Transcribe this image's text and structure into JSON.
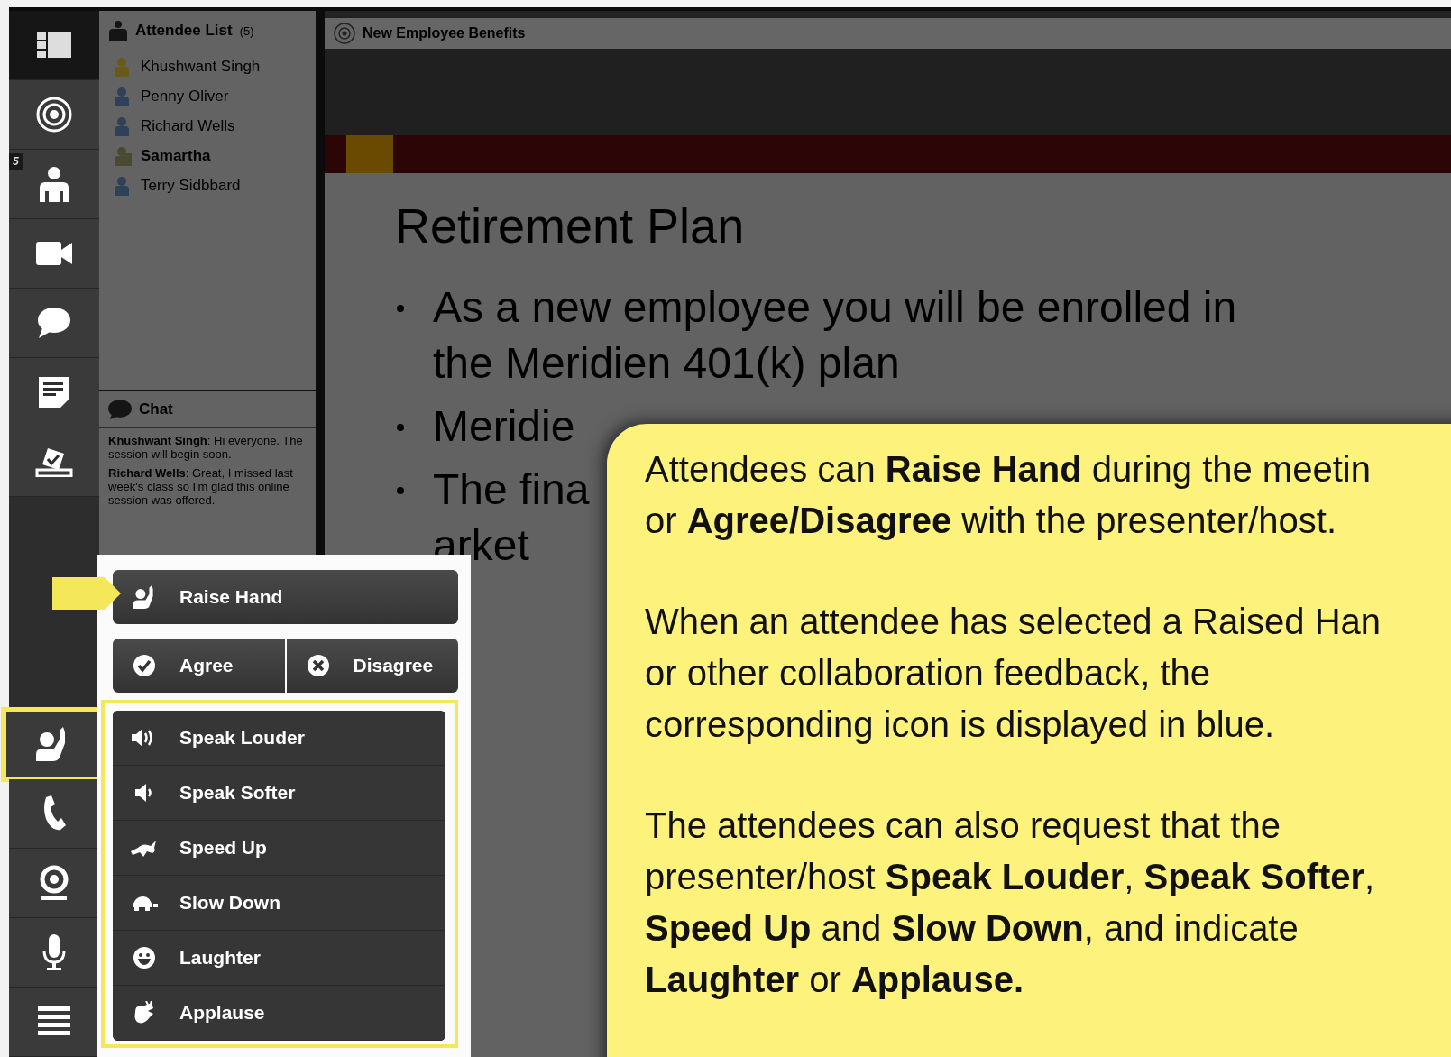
{
  "rail_top": [
    {
      "selected": true,
      "highlighted": false
    },
    {
      "selected": false,
      "highlighted": false
    },
    {
      "selected": false,
      "highlighted": false,
      "badge": "5"
    },
    {
      "selected": false,
      "highlighted": false
    },
    {
      "selected": false,
      "highlighted": false
    },
    {
      "selected": false,
      "highlighted": false
    },
    {
      "selected": false,
      "highlighted": false
    }
  ],
  "rail_bottom": [
    {
      "selected": false,
      "highlighted": true
    },
    {
      "selected": false,
      "highlighted": false
    },
    {
      "selected": false,
      "highlighted": false
    },
    {
      "selected": false,
      "highlighted": false
    },
    {
      "selected": false,
      "highlighted": false
    }
  ],
  "attendee_list": {
    "title": "Attendee List",
    "count": "(5)",
    "attendees": [
      {
        "name": "Khushwant Singh",
        "kind": "host"
      },
      {
        "name": "Penny Oliver",
        "kind": "attendee"
      },
      {
        "name": "Richard Wells",
        "kind": "attendee"
      },
      {
        "name": "Samartha",
        "kind": "me"
      },
      {
        "name": "Terry Sidbbard",
        "kind": "attendee"
      }
    ]
  },
  "chat": {
    "title": "Chat",
    "messages": [
      {
        "text": "**Khushwant Singh**: Hi everyone. The session will begin soon."
      },
      {
        "text": "**Richard Wells**: Great, I missed last week's class so I'm glad this online session was offered."
      }
    ]
  },
  "presentation": {
    "title": "New Employee Benefits",
    "slide": {
      "title": "Retirement Plan",
      "bullets": [
        {
          "lines": [
            "As a new employee you will be enrolled in",
            "the Meridien 401(k) plan"
          ]
        },
        {
          "lines": [
            "Meridie"
          ]
        },
        {
          "lines": [
            "The fina",
            "arket"
          ]
        }
      ]
    }
  },
  "feedback_menu": {
    "raise_hand": "Raise Hand",
    "agree": "Agree",
    "disagree": "Disagree",
    "options_highlighted": true,
    "options": [
      {
        "label": "Speak Louder"
      },
      {
        "label": "Speak Softer"
      },
      {
        "label": "Speed Up"
      },
      {
        "label": "Slow Down"
      },
      {
        "label": "Laughter"
      },
      {
        "label": "Applause"
      }
    ]
  },
  "callout": {
    "paragraphs": [
      {
        "lines": [
          "Attendees can **Raise Hand** during the meetin",
          "or **Agree/Disagree** with the presenter/host."
        ]
      },
      {
        "lines": [
          "When an attendee has selected a Raised Han",
          "or other collaboration feedback, the",
          "corresponding icon is displayed in blue."
        ]
      },
      {
        "lines": [
          "The attendees can also request that the",
          "presenter/host **Speak Louder**, **Speak Softer**,",
          "**Speed Up** and **Slow Down**, and indicate",
          "**Laughter** or **Applause.**"
        ]
      }
    ]
  }
}
